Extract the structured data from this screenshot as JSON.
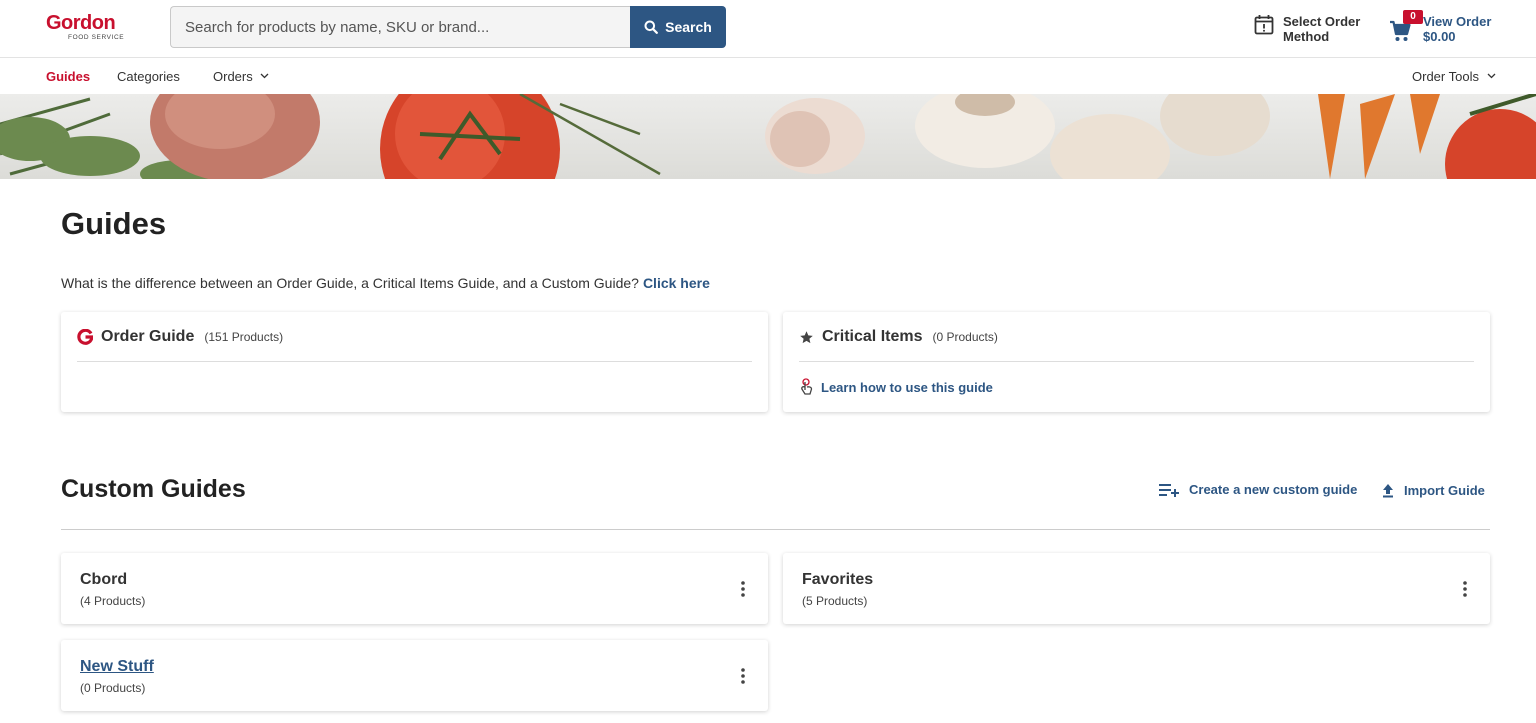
{
  "header": {
    "logo_text": "Gordon",
    "logo_subtext": "FOOD SERVICE",
    "search_placeholder": "Search for products by name, SKU or brand...",
    "search_button": "Search",
    "order_method_line1": "Select Order",
    "order_method_line2": "Method",
    "cart_count": "0",
    "view_order_line1": "View Order",
    "view_order_line2": "$0.00"
  },
  "nav": {
    "items": [
      {
        "label": "Guides",
        "active": true
      },
      {
        "label": "Categories"
      },
      {
        "label": "Orders"
      }
    ],
    "order_tools": "Order Tools"
  },
  "main": {
    "title": "Guides",
    "difference_question": "What is the difference between an Order Guide, a Critical Items Guide, and a Custom Guide?",
    "click_here": "Click here",
    "order_guide": {
      "title": "Order Guide",
      "count": "(151 Products)"
    },
    "critical_items": {
      "title": "Critical Items",
      "count": "(0 Products)",
      "learn_link": "Learn how to use this guide"
    }
  },
  "custom_guides": {
    "title": "Custom Guides",
    "create_link": "Create a new custom guide",
    "import_link": "Import Guide",
    "items": [
      {
        "name": "Cbord",
        "count": "(4 Products)"
      },
      {
        "name": "Favorites",
        "count": "(5 Products)"
      },
      {
        "name": "New Stuff",
        "count": "(0 Products)"
      }
    ]
  },
  "colors": {
    "brand_red": "#c8102e",
    "link_blue": "#2d5683"
  }
}
